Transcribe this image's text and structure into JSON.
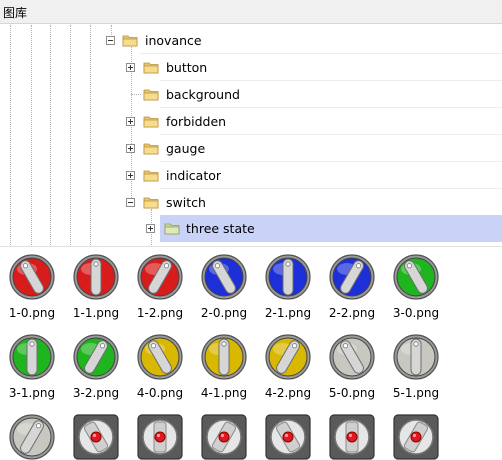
{
  "window": {
    "title": "图库"
  },
  "tree": {
    "root": {
      "label": "inovance",
      "expanded": true
    },
    "children": [
      {
        "label": "button",
        "expanded": false,
        "has_children": true
      },
      {
        "label": "background",
        "expanded": false,
        "has_children": false
      },
      {
        "label": "forbidden",
        "expanded": false,
        "has_children": true
      },
      {
        "label": "gauge",
        "expanded": false,
        "has_children": true
      },
      {
        "label": "indicator",
        "expanded": false,
        "has_children": true
      },
      {
        "label": "switch",
        "expanded": true,
        "has_children": true
      }
    ],
    "selected": {
      "label": "three state",
      "expanded": false,
      "has_children": true
    },
    "selection_color": "#c9d3f7"
  },
  "gallery": {
    "items": [
      {
        "name": "1-0.png",
        "icon": "red-rotary-switch-icon",
        "color": "#d81c1c",
        "angle": -30
      },
      {
        "name": "1-1.png",
        "icon": "red-rotary-switch-icon",
        "color": "#d81c1c",
        "angle": 0
      },
      {
        "name": "1-2.png",
        "icon": "red-rotary-switch-icon",
        "color": "#d81c1c",
        "angle": 30
      },
      {
        "name": "2-0.png",
        "icon": "blue-rotary-switch-icon",
        "color": "#1d2fd8",
        "angle": -30
      },
      {
        "name": "2-1.png",
        "icon": "blue-rotary-switch-icon",
        "color": "#1d2fd8",
        "angle": 0
      },
      {
        "name": "2-2.png",
        "icon": "blue-rotary-switch-icon",
        "color": "#1d2fd8",
        "angle": 30
      },
      {
        "name": "3-0.png",
        "icon": "green-rotary-switch-icon",
        "color": "#1fb51f",
        "angle": -30
      },
      {
        "name": "3-1.png",
        "icon": "green-rotary-switch-icon",
        "color": "#1fb51f",
        "angle": 0
      },
      {
        "name": "3-2.png",
        "icon": "green-rotary-switch-icon",
        "color": "#1fb51f",
        "angle": 30
      },
      {
        "name": "4-0.png",
        "icon": "yellow-rotary-switch-icon",
        "color": "#d8b800",
        "angle": -30
      },
      {
        "name": "4-1.png",
        "icon": "yellow-rotary-switch-icon",
        "color": "#d8b800",
        "angle": 0
      },
      {
        "name": "4-2.png",
        "icon": "yellow-rotary-switch-icon",
        "color": "#d8b800",
        "angle": 30
      },
      {
        "name": "5-0.png",
        "icon": "silver-rotary-switch-icon",
        "color": "#c8c8c0",
        "angle": -30
      },
      {
        "name": "5-1.png",
        "icon": "silver-rotary-switch-icon",
        "color": "#c8c8c0",
        "angle": 0
      },
      {
        "name": "",
        "icon": "silver-rotary-switch-icon",
        "color": "#c8c8c0",
        "angle": 30
      },
      {
        "name": "",
        "icon": "rotary-selector-knob-icon",
        "color": "#6a6a6a",
        "angle": -30
      },
      {
        "name": "",
        "icon": "rotary-selector-knob-icon",
        "color": "#6a6a6a",
        "angle": 0
      },
      {
        "name": "",
        "icon": "rotary-selector-knob-icon",
        "color": "#6a6a6a",
        "angle": 30
      },
      {
        "name": "",
        "icon": "rotary-selector-knob-icon",
        "color": "#6a6a6a",
        "angle": -30
      },
      {
        "name": "",
        "icon": "rotary-selector-knob-icon",
        "color": "#6a6a6a",
        "angle": 0
      },
      {
        "name": "",
        "icon": "rotary-selector-knob-icon",
        "color": "#6a6a6a",
        "angle": 30
      }
    ]
  }
}
